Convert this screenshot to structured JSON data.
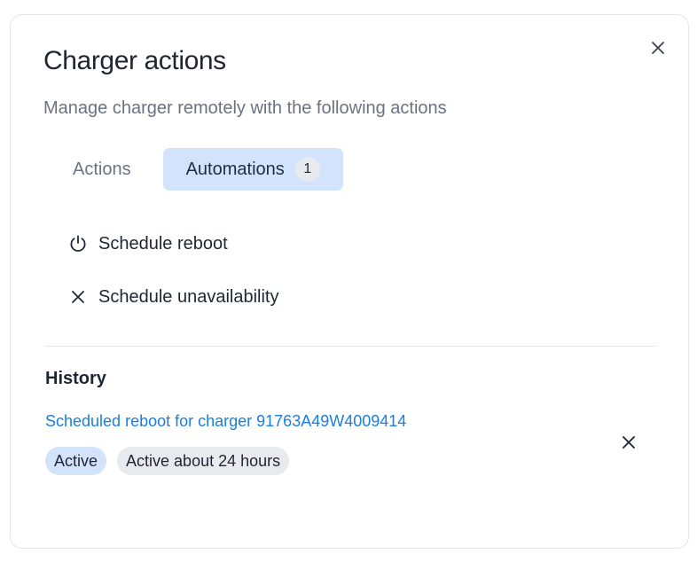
{
  "dialog": {
    "title": "Charger actions",
    "subtitle": "Manage charger remotely with the following actions",
    "close_icon": "close-icon"
  },
  "tabs": [
    {
      "label": "Actions",
      "active": false
    },
    {
      "label": "Automations",
      "active": true,
      "count": "1"
    }
  ],
  "actions": [
    {
      "label": "Schedule reboot",
      "icon": "power-icon"
    },
    {
      "label": "Schedule unavailability",
      "icon": "close-icon"
    }
  ],
  "history": {
    "title": "History",
    "items": [
      {
        "link_text": "Scheduled reboot for charger 91763A49W4009414",
        "status_badge": "Active",
        "duration_badge": "Active about 24 hours",
        "remove_icon": "close-icon"
      }
    ]
  },
  "colors": {
    "accent_bg": "#d3e3fc",
    "link": "#1a7fe0",
    "muted_text": "#6b7280",
    "badge_gray": "#e8eaed"
  }
}
